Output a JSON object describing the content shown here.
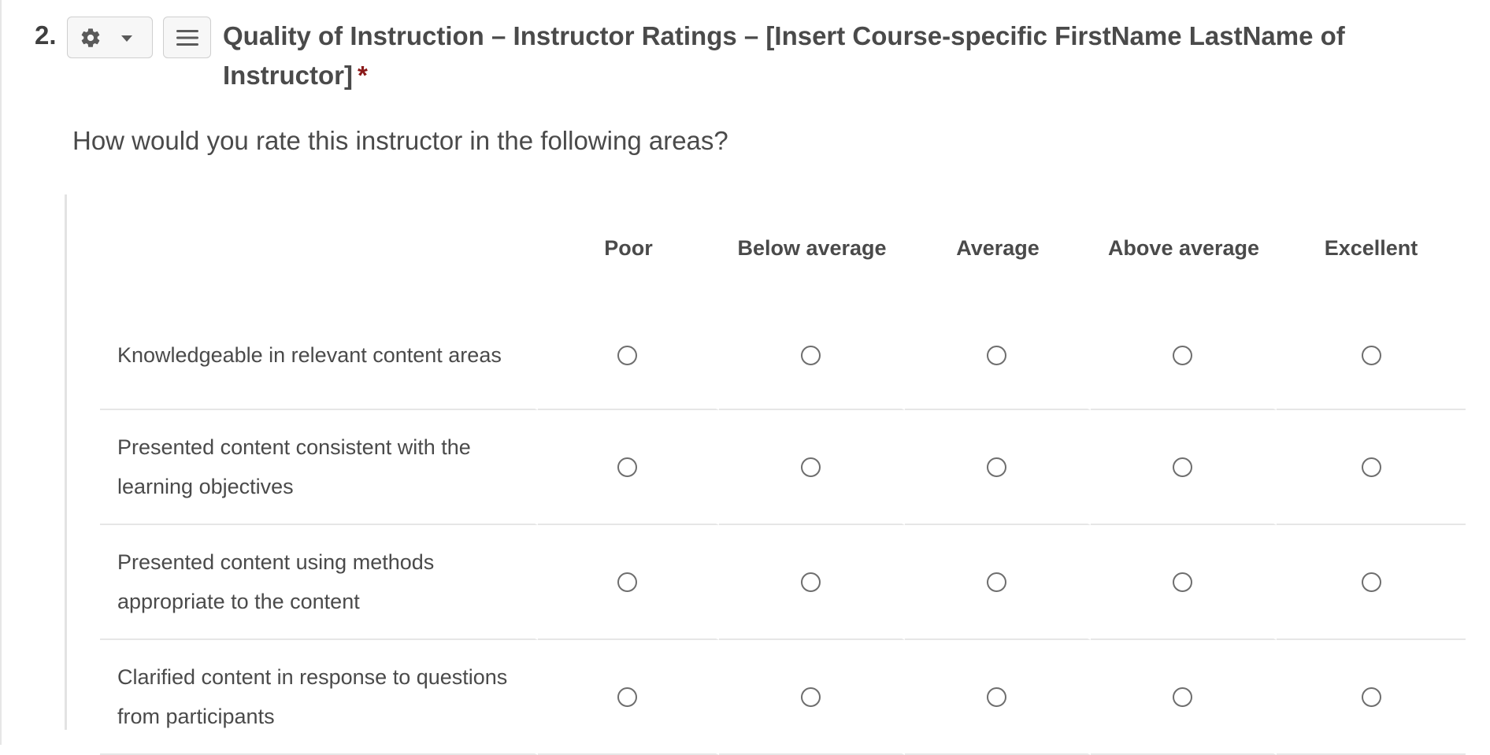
{
  "question": {
    "number": "2.",
    "title": "Quality of Instruction – Instructor Ratings – [Insert Course-specific FirstName LastName of Instructor]",
    "required_marker": "*",
    "prompt": "How would you rate this instructor in the following areas?"
  },
  "toolbar": {
    "settings_icon": "gear-icon",
    "dropdown_icon": "caret-down-icon",
    "menu_icon": "hamburger-menu-icon"
  },
  "matrix": {
    "columns": [
      "Poor",
      "Below average",
      "Average",
      "Above average",
      "Excellent"
    ],
    "rows": [
      {
        "statement": "Knowledgeable in relevant content areas",
        "selected": null
      },
      {
        "statement": "Presented content consistent with the learning objectives",
        "selected": null
      },
      {
        "statement": "Presented content using methods appropriate to the content",
        "selected": null
      },
      {
        "statement": "Clarified content in response to questions from participants",
        "selected": null
      }
    ]
  },
  "colors": {
    "text": "#4a4a4a",
    "required": "#8b1a1a",
    "divider": "#e6e6e6",
    "button_bg": "#f7f7f7",
    "button_border": "#cfcfcf"
  }
}
